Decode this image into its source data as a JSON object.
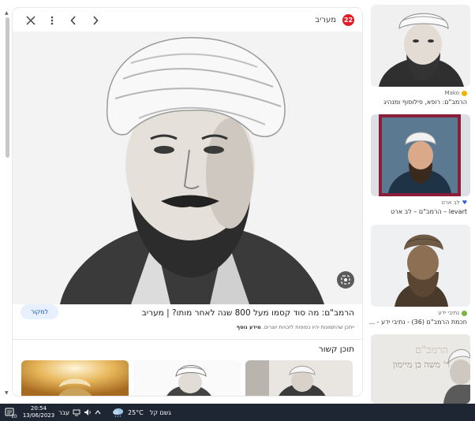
{
  "preview": {
    "source_name": "מעריב",
    "source_logo_text": "22",
    "title": "הרמב\"ם: מה סוד קסמו מעל 800 שנה לאחר מותו? | מעריב",
    "visit_label": "למקור",
    "notice_prefix": "מידע נוסף",
    "notice_text": "ייתכן שהתמונות יהיו כפופות לזכויות יוצרים.",
    "related_heading": "תוכן קשור"
  },
  "results": [
    {
      "source": "Mako",
      "caption": "הרמב\"ם: רופא, פילוסוף ומנהיג"
    },
    {
      "source": "לב ארט",
      "caption": "levart – הרמב\"ם – לב ארט"
    },
    {
      "source": "נתיבי ידע",
      "caption": "חכמת הרמב\"ם (36) - נתיבי ידע - ..."
    },
    {
      "source": "",
      "caption": "",
      "banner_line1": "הרמב\"ם",
      "banner_line2": "ר' משה בן מיימון"
    }
  ],
  "taskbar": {
    "time": "20:54",
    "date": "13/06/2023",
    "lang": "עבר",
    "weather_temp": "25°C",
    "weather_desc": "גשם קל",
    "notif_count": "10"
  },
  "colors": {
    "accent": "#1a57c8",
    "source_logo": "#e11c24",
    "taskbar": "#1e2633"
  }
}
